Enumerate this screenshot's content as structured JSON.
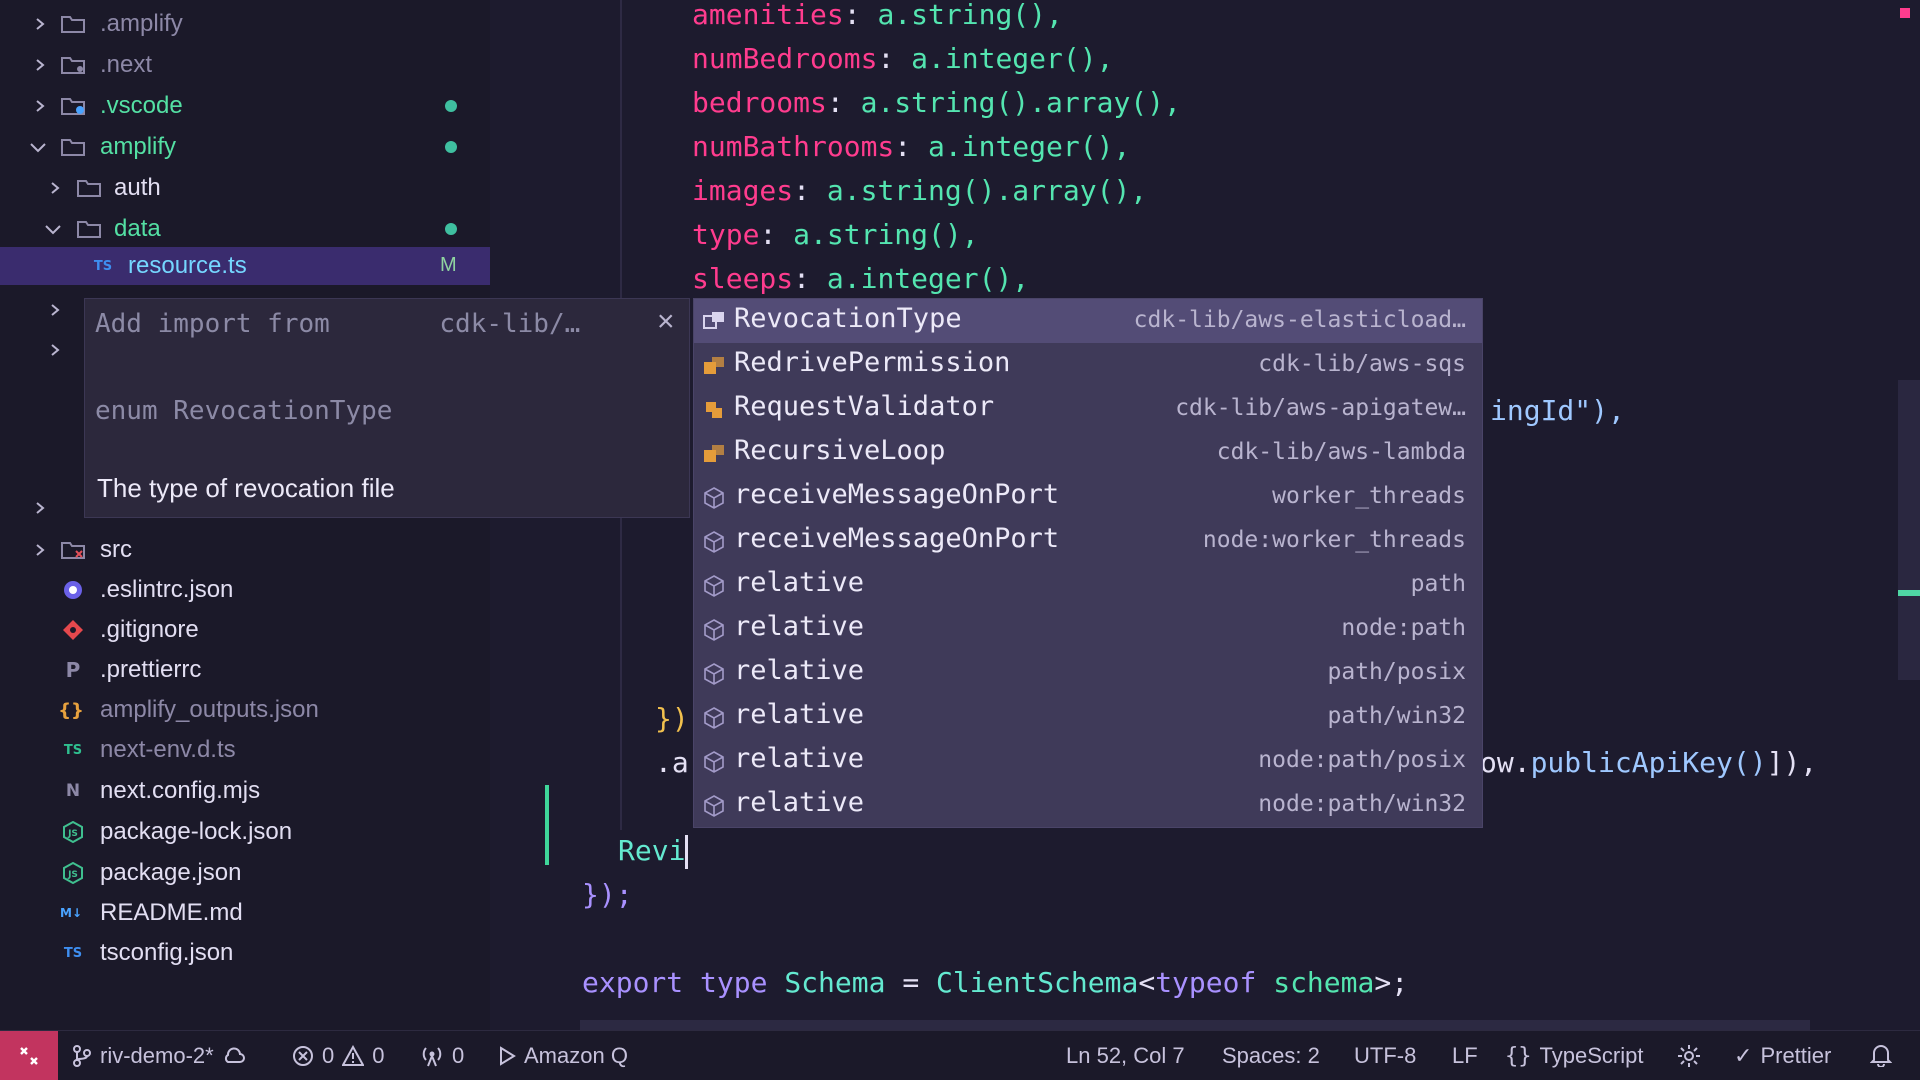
{
  "explorer": {
    "items": [
      {
        "label": ".amplify",
        "icon": "folder-icon",
        "state": "collapsed"
      },
      {
        "label": ".next",
        "icon": "folder-icon",
        "state": "collapsed"
      },
      {
        "label": ".vscode",
        "icon": "vscode-folder-icon",
        "state": "collapsed"
      },
      {
        "label": "amplify",
        "icon": "folder-icon",
        "state": "expanded"
      },
      {
        "label": "auth",
        "icon": "folder-icon",
        "state": "collapsed"
      },
      {
        "label": "data",
        "icon": "folder-icon",
        "state": "expanded"
      },
      {
        "label": "resource.ts",
        "icon": "typescript-file-icon",
        "badge": "M"
      },
      {
        "label": "src",
        "icon": "src-folder-icon",
        "state": "collapsed"
      },
      {
        "label": ".eslintrc.json",
        "icon": "eslint-file-icon"
      },
      {
        "label": ".gitignore",
        "icon": "git-file-icon"
      },
      {
        "label": ".prettierrc",
        "icon": "prettier-file-icon"
      },
      {
        "label": "amplify_outputs.json",
        "icon": "json-file-icon"
      },
      {
        "label": "next-env.d.ts",
        "icon": "typescript-file-icon"
      },
      {
        "label": "next.config.mjs",
        "icon": "next-file-icon"
      },
      {
        "label": "package-lock.json",
        "icon": "npm-file-icon"
      },
      {
        "label": "package.json",
        "icon": "npm-file-icon"
      },
      {
        "label": "README.md",
        "icon": "markdown-file-icon"
      },
      {
        "label": "tsconfig.json",
        "icon": "tsconfig-file-icon"
      }
    ]
  },
  "editor": {
    "lines": [
      {
        "prop": "amenities",
        "tail": "a.string(),"
      },
      {
        "prop": "numBedrooms",
        "tail": "a.integer(),"
      },
      {
        "prop": "bedrooms",
        "tail": "a.string().array(),"
      },
      {
        "prop": "numBathrooms",
        "tail": "a.integer(),"
      },
      {
        "prop": "images",
        "tail": "a.string().array(),"
      },
      {
        "prop": "type",
        "tail": "a.string(),"
      },
      {
        "prop": "sleeps",
        "tail": "a.integer(),"
      }
    ],
    "partial_right_1": "ingId\"),",
    "partial_brace": "})",
    "partial_a": ".a",
    "partial_right_2_dim": "ow.",
    "partial_right_2_fn": "publicApiKey()",
    "partial_right_2_end": "]),",
    "typed": "Revi",
    "close_brace": "});",
    "export_line": {
      "kw1": "export",
      "kw2": "type",
      "name": "Schema",
      "eq": "=",
      "type": "ClientSchema",
      "lt": "<",
      "kw3": "typeof",
      "arg": "schema",
      "end": ">;"
    }
  },
  "hover": {
    "import_prefix": "Add import from",
    "import_module": "cdk-lib/…",
    "close_label": "×",
    "signature": "enum RevocationType",
    "description": "The type of revocation file"
  },
  "suggestions": [
    {
      "label": "RevocationType",
      "detail": "cdk-lib/aws-elasticload…",
      "kind": "enum-icon",
      "focused": true
    },
    {
      "label": "RedrivePermission",
      "detail": "cdk-lib/aws-sqs",
      "kind": "enum-icon"
    },
    {
      "label": "RequestValidator",
      "detail": "cdk-lib/aws-apigatew…",
      "kind": "class-icon"
    },
    {
      "label": "RecursiveLoop",
      "detail": "cdk-lib/aws-lambda",
      "kind": "enum-icon"
    },
    {
      "label": "receiveMessageOnPort",
      "detail": "worker_threads",
      "kind": "method-icon"
    },
    {
      "label": "receiveMessageOnPort",
      "detail": "node:worker_threads",
      "kind": "method-icon"
    },
    {
      "label": "relative",
      "detail": "path",
      "kind": "method-icon"
    },
    {
      "label": "relative",
      "detail": "node:path",
      "kind": "method-icon"
    },
    {
      "label": "relative",
      "detail": "path/posix",
      "kind": "method-icon"
    },
    {
      "label": "relative",
      "detail": "path/win32",
      "kind": "method-icon"
    },
    {
      "label": "relative",
      "detail": "node:path/posix",
      "kind": "method-icon"
    },
    {
      "label": "relative",
      "detail": "node:path/win32",
      "kind": "method-icon"
    }
  ],
  "status": {
    "branch": "riv-demo-2*",
    "errors": "0",
    "warnings": "0",
    "ports": "0",
    "amazon_q": "Amazon Q",
    "position": "Ln 52, Col 7",
    "spaces": "Spaces: 2",
    "encoding": "UTF-8",
    "eol": "LF",
    "language": "TypeScript",
    "prettier": "Prettier"
  }
}
